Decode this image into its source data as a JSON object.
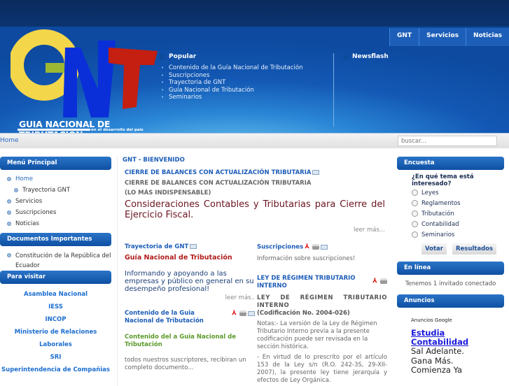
{
  "header": {
    "logo_title": "GUIA NACIONAL DE TRIBUTACION",
    "logo_subtitle": "en el desarrollo del país",
    "topnav": [
      "GNT",
      "Servicios",
      "Noticias"
    ],
    "popular": {
      "title": "Popular",
      "items": [
        "Contenido de la Guía Nacional de Tributación",
        "Suscripciones",
        "Trayectoria de GNT",
        "Guía Nacional de Tributación",
        "Seminarios"
      ]
    },
    "newsflash": {
      "title": "Newsflash"
    }
  },
  "breadcrumb": {
    "home": "Home"
  },
  "search": {
    "placeholder": "buscar..."
  },
  "left": {
    "menu_title": "Menú Principal",
    "menu": [
      "Home",
      "Trayectoria GNT",
      "Servicios",
      "Suscripciones",
      "Noticias"
    ],
    "docs_title": "Documentos Importantes",
    "docs": [
      "Constitución de la República del Ecuador"
    ],
    "visit_title": "Para visitar",
    "visit": [
      "Asamblea Nacional",
      "IESS",
      "INCOP",
      "Ministerio de Relaciones",
      "Laborales",
      "SRI",
      "Superintendencia de Compañias"
    ]
  },
  "main": {
    "section": "GNT - BIENVENIDO",
    "lead": {
      "title": "CIERRE DE BALANCES CON ACTUALIZACIÓN TRIBUTARIA",
      "sub1": "CIERRE DE BALANCES CON ACTUALIZACIÓN TRIBUTARIA",
      "sub2": "(LO MÁS INDISPENSABLE)",
      "headline": "Consideraciones Contables y Tributarias para Cierre del Ejercicio Fiscal.",
      "more": "leer más..."
    },
    "trayectoria": {
      "title": "Trayectoria de GNT",
      "red": "Guía Nacional de Tributación",
      "body": "Informando y apoyando a las empresas y público en general en su desempeño profesional!",
      "more": "leer más.."
    },
    "contenido": {
      "title": "Contenido de la Guia Nacional de Tributación",
      "green": "Contenido del a Guia Nacional de Tributación",
      "body": "todos nuestros suscriptores, recibiran un completo documento..."
    },
    "suscripciones": {
      "title": "Suscripciones",
      "body": "Información sobre suscripciones!"
    },
    "ley": {
      "title": "LEY DE RÉGIMEN TRIBUTARIO INTERNO",
      "sub": "LEY DE RÉGIMEN TRIBUTARIO INTERNO",
      "code": "(Codificación No. 2004-026)",
      "p1": "Notas:- La versión de la Ley de Régimen Tributario Interno previa a la presente codificación puede ser revisada en la sección histórica.",
      "p2": "- En virtud de lo prescrito por el artículo 153 de la Ley s/n (R.O. 242-3S, 29-XII-2007), la presente ley tiene jerarquía y efectos de Ley Orgánica."
    }
  },
  "right": {
    "poll_title": "Encuesta",
    "question": "¿En qué tema está interesado?",
    "options": [
      "Leyes",
      "Reglamentos",
      "Tributación",
      "Contabilidad",
      "Seminarios"
    ],
    "vote": "Votar",
    "results": "Resultados",
    "online_title": "En línea",
    "online": "Tenemos 1 invitado conectado",
    "ads_title": "Anuncios",
    "ads_label": "Anuncios Google",
    "ad_link": "Estudia Contabilidad",
    "ad_text": "Sal Adelante. Gana Más. Comienza Ya"
  }
}
